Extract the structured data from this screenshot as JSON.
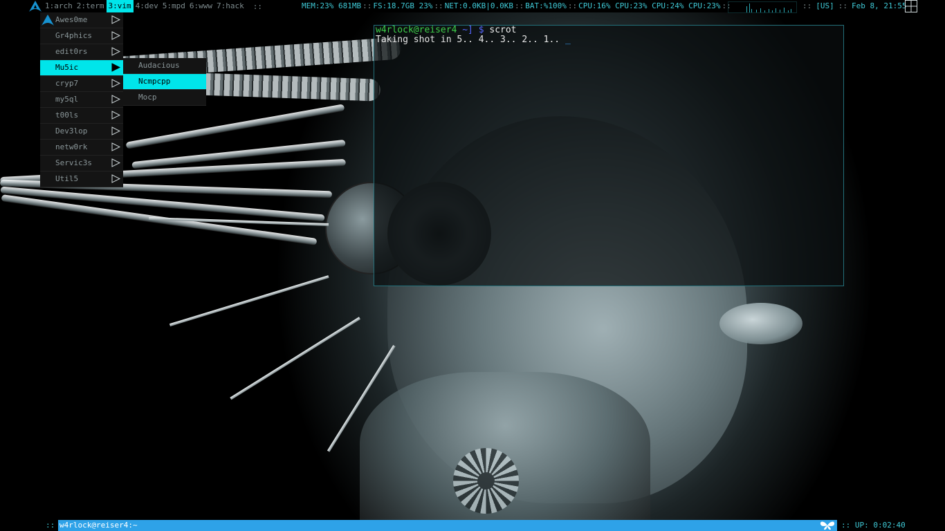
{
  "topbar": {
    "logo_icon": "arch-linux-icon",
    "tags": [
      {
        "label": "1:arch",
        "active": false
      },
      {
        "label": "2:term",
        "active": false
      },
      {
        "label": "3:vim",
        "active": true
      },
      {
        "label": "4:dev",
        "active": false
      },
      {
        "label": "5:mpd",
        "active": false
      },
      {
        "label": "6:www",
        "active": false
      },
      {
        "label": "7:hack",
        "active": false
      }
    ],
    "tag_separator": "::",
    "status": {
      "mem": "MEM:23% 681MB",
      "fs": "FS:18.7GB 23%",
      "net": "NET:0.0KB|0.0KB",
      "bat": "BAT:%100%",
      "cpu": "CPU:16% CPU:23% CPU:24% CPU:23%",
      "sep": "::"
    },
    "keyboard": "[US]",
    "datetime": "Feb  8, 21:55",
    "layout_icon": "tile-layout-icon",
    "accent": "#00e5ea",
    "text_color": "#3fc9d6"
  },
  "menu": {
    "items": [
      {
        "label": "Awes0me",
        "icon": "arch-logo-icon",
        "selected": false
      },
      {
        "label": "Gr4phics",
        "selected": false
      },
      {
        "label": "edit0rs",
        "selected": false
      },
      {
        "label": "Mu5ic",
        "selected": true
      },
      {
        "label": "cryp7",
        "selected": false
      },
      {
        "label": "my5ql",
        "selected": false
      },
      {
        "label": "t00ls",
        "selected": false
      },
      {
        "label": "Dev3lop",
        "selected": false
      },
      {
        "label": "netw0rk",
        "selected": false
      },
      {
        "label": "Servic3s",
        "selected": false
      },
      {
        "label": "Util5",
        "selected": false
      }
    ],
    "submenu": {
      "items": [
        {
          "label": "Audacious",
          "selected": false
        },
        {
          "label": "Ncmpcpp",
          "selected": true
        },
        {
          "label": "Mocp",
          "selected": false
        }
      ]
    }
  },
  "terminal": {
    "prompt_user": "w4rlock@reiser4",
    "prompt_path": " ~] $",
    "command": " scrot",
    "output": "Taking shot in 5.. 4.. 3.. 2.. 1.. ",
    "cursor": "_"
  },
  "bottombar": {
    "separator": "::",
    "task": "w4rlock@reiser4:~",
    "task_icon": "butterfly-icon",
    "uptime": ":: UP: 0:02:40",
    "task_color": "#2ea2e8"
  }
}
